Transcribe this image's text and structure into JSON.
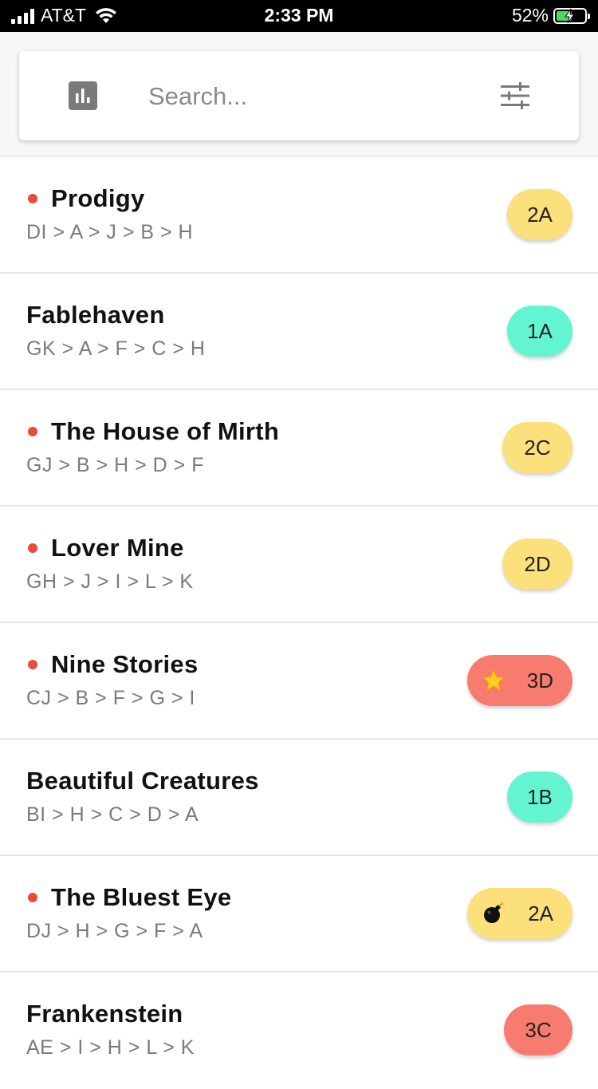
{
  "status_bar": {
    "carrier": "AT&T",
    "time": "2:33 PM",
    "battery": "52%"
  },
  "search": {
    "placeholder": "Search...",
    "left_icon": "bar-chart-icon",
    "right_icon": "sliders-icon"
  },
  "colors": {
    "yellow": "#fbe07c",
    "teal": "#63f5d2",
    "red": "#f77b6e",
    "dot": "#e94b3c"
  },
  "items": [
    {
      "title": "Prodigy",
      "path": "DI > A > J > B > H",
      "badge": "2A",
      "badge_color": "yellow",
      "dot": true,
      "badge_icon": null
    },
    {
      "title": "Fablehaven",
      "path": "GK > A > F > C > H",
      "badge": "1A",
      "badge_color": "teal",
      "dot": false,
      "badge_icon": null
    },
    {
      "title": "The House of Mirth",
      "path": "GJ > B > H > D > F",
      "badge": "2C",
      "badge_color": "yellow",
      "dot": true,
      "badge_icon": null
    },
    {
      "title": "Lover Mine",
      "path": "GH > J > I > L > K",
      "badge": "2D",
      "badge_color": "yellow",
      "dot": true,
      "badge_icon": null
    },
    {
      "title": "Nine Stories",
      "path": "CJ > B > F > G > I",
      "badge": "3D",
      "badge_color": "red",
      "dot": true,
      "badge_icon": "star-icon"
    },
    {
      "title": "Beautiful Creatures",
      "path": "BI > H > C > D > A",
      "badge": "1B",
      "badge_color": "teal",
      "dot": false,
      "badge_icon": null
    },
    {
      "title": "The Bluest Eye",
      "path": "DJ > H > G > F > A",
      "badge": "2A",
      "badge_color": "yellow",
      "dot": true,
      "badge_icon": "bomb-icon"
    },
    {
      "title": "Frankenstein",
      "path": "AE > I > H > L > K",
      "badge": "3C",
      "badge_color": "red",
      "dot": false,
      "badge_icon": null
    }
  ]
}
